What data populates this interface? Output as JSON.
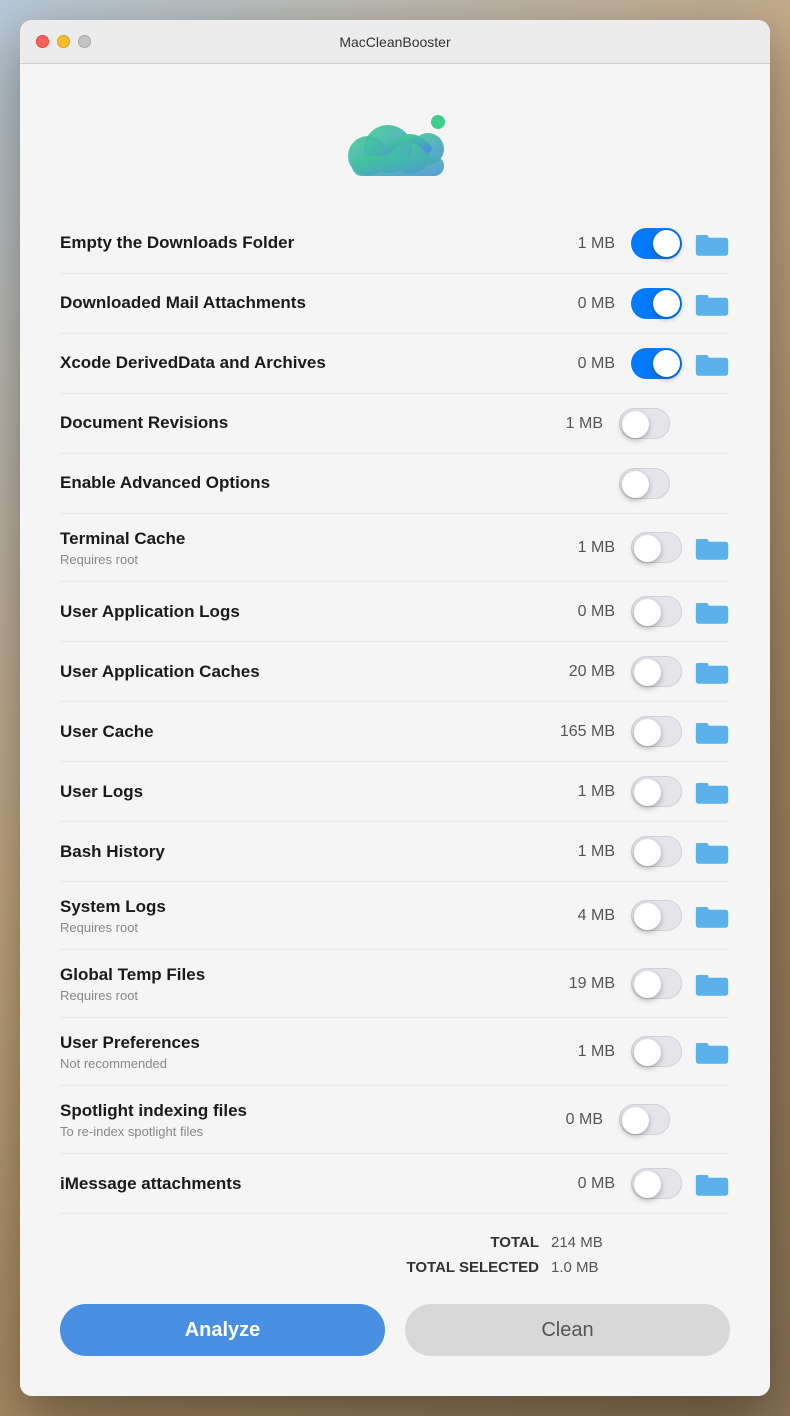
{
  "window": {
    "title": "MacCleanBooster"
  },
  "buttons": {
    "analyze": "Analyze",
    "clean": "Clean"
  },
  "totals": {
    "total_label": "TOTAL",
    "total_value": "214 MB",
    "total_selected_label": "TOTAL SELECTED",
    "total_selected_value": "1.0 MB"
  },
  "items": [
    {
      "id": "empty-downloads",
      "title": "Empty the Downloads Folder",
      "subtitle": "",
      "size": "1 MB",
      "toggle": "on",
      "folder": true
    },
    {
      "id": "downloaded-mail",
      "title": "Downloaded Mail Attachments",
      "subtitle": "",
      "size": "0 MB",
      "toggle": "on",
      "folder": true
    },
    {
      "id": "xcode-derived",
      "title": "Xcode DerivedData and Archives",
      "subtitle": "",
      "size": "0 MB",
      "toggle": "on",
      "folder": true
    },
    {
      "id": "document-revisions",
      "title": "Document Revisions",
      "subtitle": "",
      "size": "1 MB",
      "toggle": "off",
      "folder": false
    },
    {
      "id": "enable-advanced",
      "title": "Enable Advanced Options",
      "subtitle": "",
      "size": "",
      "toggle": "off",
      "folder": false
    },
    {
      "id": "terminal-cache",
      "title": "Terminal Cache",
      "subtitle": "Requires root",
      "size": "1 MB",
      "toggle": "off",
      "folder": true
    },
    {
      "id": "user-app-logs",
      "title": "User Application Logs",
      "subtitle": "",
      "size": "0 MB",
      "toggle": "off",
      "folder": true
    },
    {
      "id": "user-app-caches",
      "title": "User Application Caches",
      "subtitle": "",
      "size": "20 MB",
      "toggle": "off",
      "folder": true
    },
    {
      "id": "user-cache",
      "title": "User Cache",
      "subtitle": "",
      "size": "165 MB",
      "toggle": "off",
      "folder": true
    },
    {
      "id": "user-logs",
      "title": "User Logs",
      "subtitle": "",
      "size": "1 MB",
      "toggle": "off",
      "folder": true
    },
    {
      "id": "bash-history",
      "title": "Bash History",
      "subtitle": "",
      "size": "1 MB",
      "toggle": "off",
      "folder": true
    },
    {
      "id": "system-logs",
      "title": "System Logs",
      "subtitle": "Requires root",
      "size": "4 MB",
      "toggle": "off",
      "folder": true
    },
    {
      "id": "global-temp",
      "title": "Global Temp Files",
      "subtitle": "Requires root",
      "size": "19 MB",
      "toggle": "off",
      "folder": true
    },
    {
      "id": "user-preferences",
      "title": "User Preferences",
      "subtitle": "Not recommended",
      "size": "1 MB",
      "toggle": "off",
      "folder": true
    },
    {
      "id": "spotlight-indexing",
      "title": "Spotlight indexing files",
      "subtitle": "To re-index spotlight files",
      "size": "0 MB",
      "toggle": "off",
      "folder": false
    },
    {
      "id": "imessage-attachments",
      "title": "iMessage attachments",
      "subtitle": "",
      "size": "0 MB",
      "toggle": "off",
      "folder": true
    }
  ]
}
